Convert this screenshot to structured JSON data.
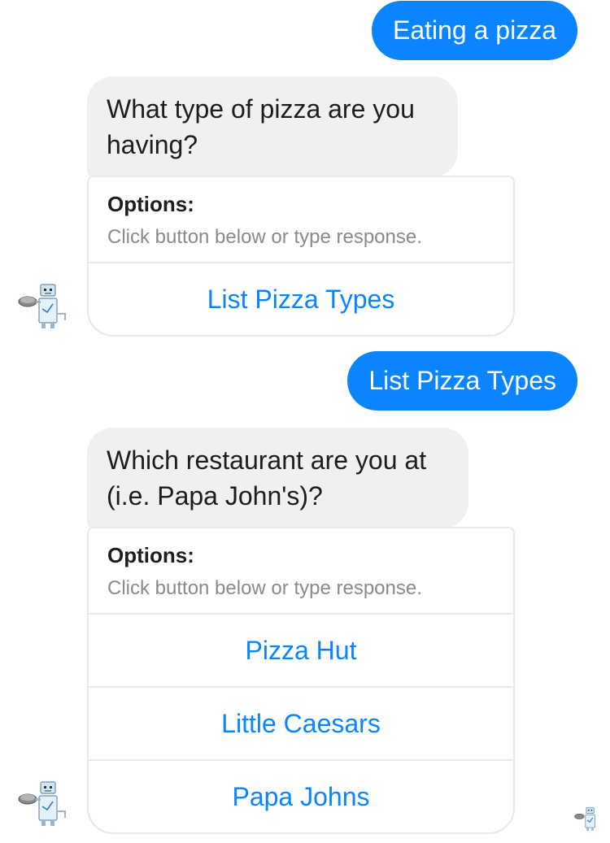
{
  "conversation": {
    "msg1_user": "Eating a pizza",
    "msg2_bot": "What type of pizza are you having?",
    "card1": {
      "title": "Options:",
      "subtitle": "Click button below or type response.",
      "buttons": [
        "List Pizza Types"
      ]
    },
    "msg3_user": "List Pizza Types",
    "msg4_bot": "Which restaurant are you at (i.e. Papa John's)?",
    "card2": {
      "title": "Options:",
      "subtitle": "Click button below or type response.",
      "buttons": [
        "Pizza Hut",
        "Little Caesars",
        "Papa Johns"
      ]
    }
  },
  "colors": {
    "user_bubble": "#0a84ff",
    "bot_bubble": "#f0f0f0",
    "button_text": "#0a84ff",
    "card_border": "#e8e8e8"
  },
  "icons": {
    "bot_avatar": "robot-holding-pizza-icon",
    "read_receipt": "robot-read-receipt-icon"
  }
}
